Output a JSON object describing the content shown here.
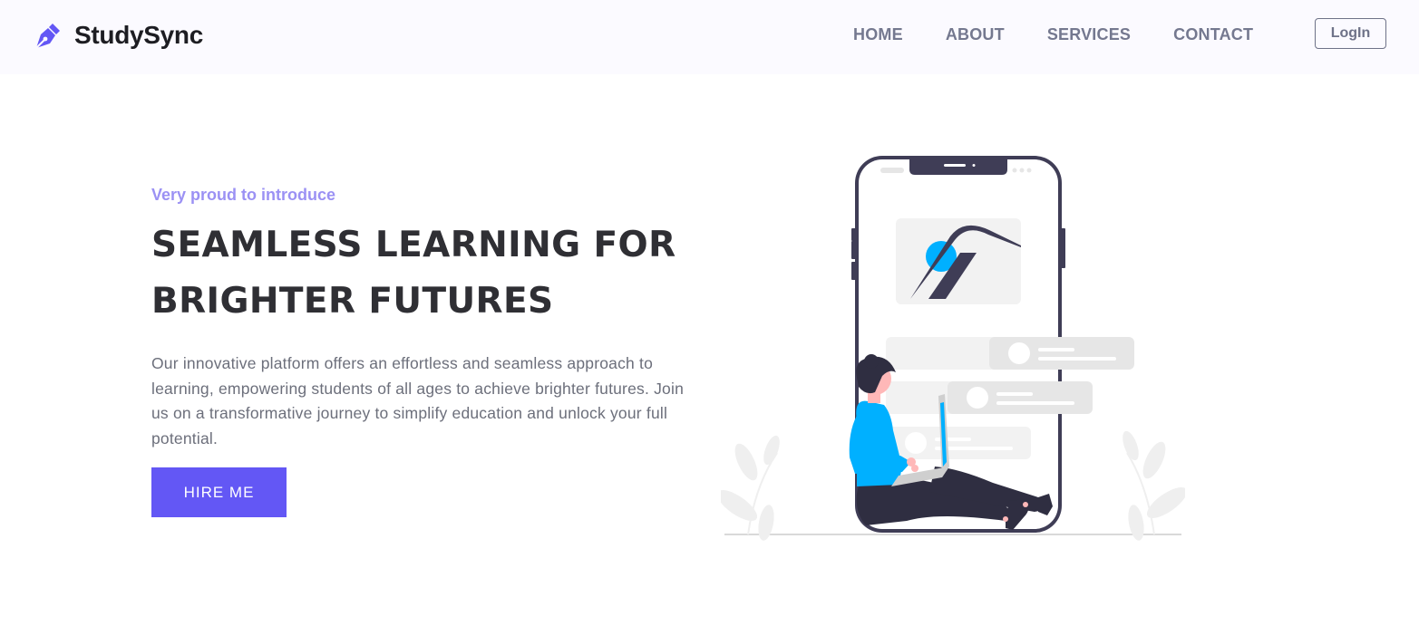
{
  "nav": {
    "brand": "StudySync",
    "brand_icon": "pen-nib-icon",
    "links": [
      "HOME",
      "ABOUT",
      "SERVICES",
      "CONTACT"
    ],
    "login_label": "LogIn"
  },
  "hero": {
    "eyebrow": "Very proud to introduce",
    "headline_line1": "SEAMLESS LEARNING FOR",
    "headline_line2": "BRIGHTER FUTURES",
    "description": "Our innovative platform offers an effortless and seamless approach to learning, empowering students of all ages to achieve brighter futures. Join us on a transformative journey to simplify education and unlock your full potential.",
    "cta_label": "HIRE ME"
  },
  "colors": {
    "accent": "#6357f5",
    "eyebrow": "#9b91f4",
    "nav_bg": "#fbfaff",
    "nav_text": "#74788f",
    "illustration_blue": "#00b0ff",
    "illustration_dark": "#3f3d56"
  }
}
